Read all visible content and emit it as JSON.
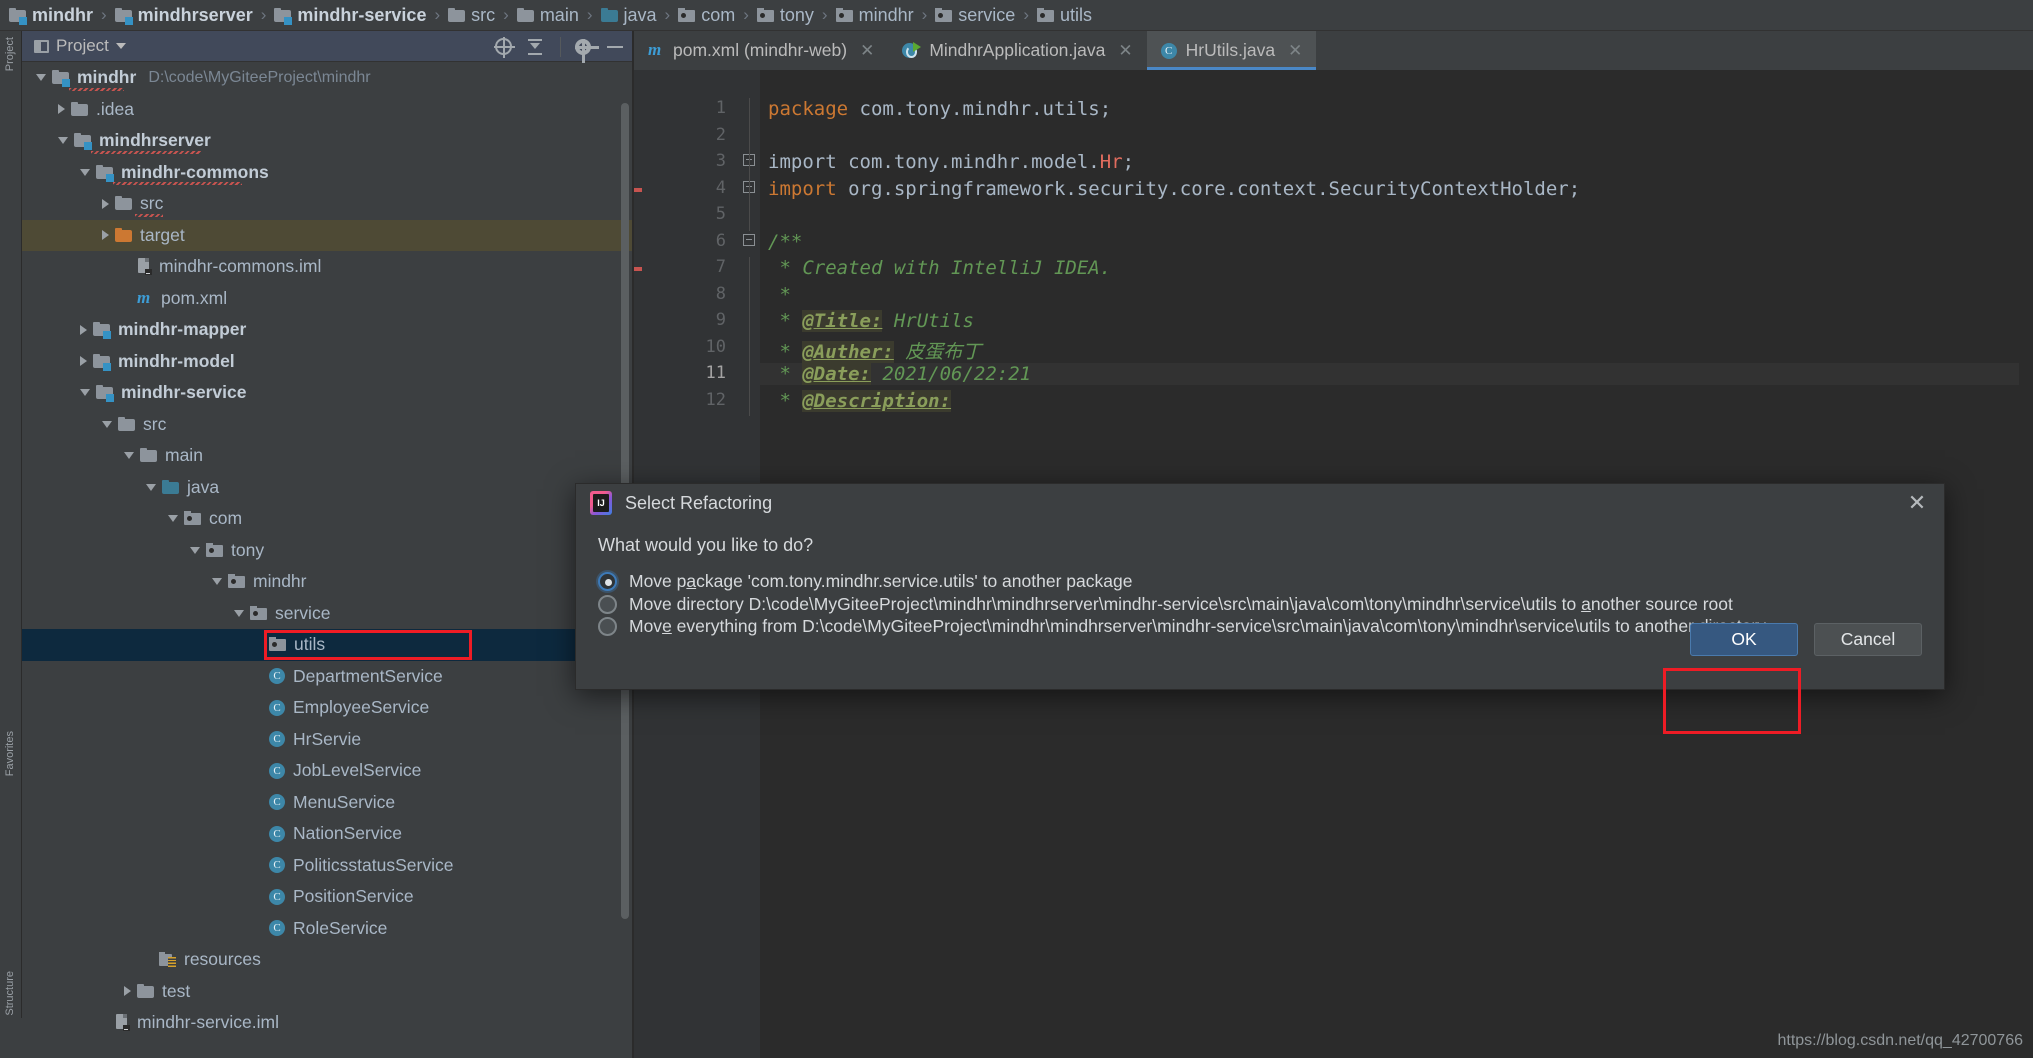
{
  "breadcrumb": [
    {
      "label": "mindhr",
      "icon": "module-folder-icon",
      "bold": true
    },
    {
      "label": "mindhrserver",
      "icon": "module-folder-icon",
      "bold": true
    },
    {
      "label": "mindhr-service",
      "icon": "module-folder-icon",
      "bold": true
    },
    {
      "label": "src",
      "icon": "folder-icon",
      "bold": false
    },
    {
      "label": "main",
      "icon": "folder-icon",
      "bold": false
    },
    {
      "label": "java",
      "icon": "source-folder-icon",
      "bold": false
    },
    {
      "label": "com",
      "icon": "package-folder-icon",
      "bold": false
    },
    {
      "label": "tony",
      "icon": "package-folder-icon",
      "bold": false
    },
    {
      "label": "mindhr",
      "icon": "package-folder-icon",
      "bold": false
    },
    {
      "label": "service",
      "icon": "package-folder-icon",
      "bold": false
    },
    {
      "label": "utils",
      "icon": "package-folder-icon",
      "bold": false
    }
  ],
  "left_rail": {
    "project": "Project",
    "favorites": "Favorites",
    "structure": "Structure"
  },
  "project_panel": {
    "title": "Project",
    "tools": [
      "locate-icon",
      "collapse-all-icon",
      "settings-gear-icon",
      "hide-icon"
    ]
  },
  "tree": [
    {
      "indent": 0,
      "arrow": "open",
      "icon": "module-folder-icon",
      "label": "mindhr",
      "bold": true,
      "path": "D:\\code\\MyGiteeProject\\mindhr",
      "squiggle": true
    },
    {
      "indent": 1,
      "arrow": "closed",
      "icon": "folder-icon",
      "label": ".idea",
      "bold": false
    },
    {
      "indent": 1,
      "arrow": "open",
      "icon": "module-folder-icon",
      "label": "mindhrserver",
      "bold": true,
      "squiggle": true
    },
    {
      "indent": 2,
      "arrow": "open",
      "icon": "module-folder-icon",
      "label": "mindhr-commons",
      "bold": true,
      "squiggle": true
    },
    {
      "indent": 3,
      "arrow": "closed",
      "icon": "folder-icon",
      "label": "src",
      "bold": false,
      "squiggle": true
    },
    {
      "indent": 3,
      "arrow": "closed",
      "icon": "folder-orange-icon",
      "label": "target",
      "bold": false,
      "highlight": true
    },
    {
      "indent": 4,
      "arrow": "none",
      "icon": "iml-file-icon",
      "label": "mindhr-commons.iml",
      "bold": false
    },
    {
      "indent": 4,
      "arrow": "none",
      "icon": "maven-pom-icon",
      "label": "pom.xml",
      "bold": false
    },
    {
      "indent": 2,
      "arrow": "closed",
      "icon": "module-folder-icon",
      "label": "mindhr-mapper",
      "bold": true
    },
    {
      "indent": 2,
      "arrow": "closed",
      "icon": "module-folder-icon",
      "label": "mindhr-model",
      "bold": true
    },
    {
      "indent": 2,
      "arrow": "open",
      "icon": "module-folder-icon",
      "label": "mindhr-service",
      "bold": true
    },
    {
      "indent": 3,
      "arrow": "open",
      "icon": "folder-icon",
      "label": "src",
      "bold": false
    },
    {
      "indent": 4,
      "arrow": "open",
      "icon": "folder-icon",
      "label": "main",
      "bold": false
    },
    {
      "indent": 5,
      "arrow": "open",
      "icon": "source-folder-icon",
      "label": "java",
      "bold": false
    },
    {
      "indent": 6,
      "arrow": "open",
      "icon": "package-folder-icon",
      "label": "com",
      "bold": false
    },
    {
      "indent": 7,
      "arrow": "open",
      "icon": "package-folder-icon",
      "label": "tony",
      "bold": false
    },
    {
      "indent": 8,
      "arrow": "open",
      "icon": "package-folder-icon",
      "label": "mindhr",
      "bold": false
    },
    {
      "indent": 9,
      "arrow": "open",
      "icon": "package-folder-icon",
      "label": "service",
      "bold": false
    },
    {
      "indent": 10,
      "arrow": "none",
      "icon": "package-folder-icon",
      "label": "utils",
      "bold": false,
      "selected": true,
      "annotated": true
    },
    {
      "indent": 10,
      "arrow": "none",
      "icon": "java-class-icon",
      "label": "DepartmentService",
      "bold": false
    },
    {
      "indent": 10,
      "arrow": "none",
      "icon": "java-class-icon",
      "label": "EmployeeService",
      "bold": false
    },
    {
      "indent": 10,
      "arrow": "none",
      "icon": "java-class-icon",
      "label": "HrServie",
      "bold": false
    },
    {
      "indent": 10,
      "arrow": "none",
      "icon": "java-class-icon",
      "label": "JobLevelService",
      "bold": false
    },
    {
      "indent": 10,
      "arrow": "none",
      "icon": "java-class-icon",
      "label": "MenuService",
      "bold": false
    },
    {
      "indent": 10,
      "arrow": "none",
      "icon": "java-class-icon",
      "label": "NationService",
      "bold": false
    },
    {
      "indent": 10,
      "arrow": "none",
      "icon": "java-class-icon",
      "label": "PoliticsstatusService",
      "bold": false
    },
    {
      "indent": 10,
      "arrow": "none",
      "icon": "java-class-icon",
      "label": "PositionService",
      "bold": false
    },
    {
      "indent": 10,
      "arrow": "none",
      "icon": "java-class-icon",
      "label": "RoleService",
      "bold": false
    },
    {
      "indent": 5,
      "arrow": "none",
      "icon": "resources-folder-icon",
      "label": "resources",
      "bold": false
    },
    {
      "indent": 4,
      "arrow": "closed",
      "icon": "folder-icon",
      "label": "test",
      "bold": false
    },
    {
      "indent": 3,
      "arrow": "none",
      "icon": "iml-file-icon",
      "label": "mindhr-service.iml",
      "bold": false
    }
  ],
  "editor": {
    "tabs": [
      {
        "label": "pom.xml (mindhr-web)",
        "icon": "maven-pom-icon",
        "active": false,
        "closable": true
      },
      {
        "label": "MindhrApplication.java",
        "icon": "spring-boot-icon",
        "active": false,
        "closable": true
      },
      {
        "label": "HrUtils.java",
        "icon": "java-class-icon",
        "active": true,
        "closable": true
      }
    ],
    "line_numbers": [
      "1",
      "2",
      "3",
      "4",
      "5",
      "6",
      "7",
      "8",
      "9",
      "10",
      "11",
      "12"
    ],
    "current_line": "11",
    "code_lines": [
      {
        "n": 1,
        "tokens": [
          {
            "t": "package ",
            "c": "kw"
          },
          {
            "t": "com.tony.mindhr.utils;",
            "c": "pl"
          }
        ]
      },
      {
        "n": 2,
        "tokens": []
      },
      {
        "n": 3,
        "tokens": [
          {
            "t": "import ",
            "c": "pl"
          },
          {
            "t": "com.tony.mindhr.model.",
            "c": "pl"
          },
          {
            "t": "Hr",
            "c": "cls"
          },
          {
            "t": ";",
            "c": "pl"
          }
        ]
      },
      {
        "n": 4,
        "tokens": [
          {
            "t": "import ",
            "c": "kw"
          },
          {
            "t": "org.springframework.security.core.context.SecurityContextHolder;",
            "c": "pl"
          }
        ]
      },
      {
        "n": 5,
        "tokens": []
      },
      {
        "n": 6,
        "tokens": [
          {
            "t": "/**",
            "c": "cmt"
          }
        ]
      },
      {
        "n": 7,
        "tokens": [
          {
            "t": " * Created with IntelliJ IDEA.",
            "c": "cmt"
          }
        ]
      },
      {
        "n": 8,
        "tokens": [
          {
            "t": " *",
            "c": "cmt"
          }
        ]
      },
      {
        "n": 9,
        "tokens": [
          {
            "t": " * ",
            "c": "cmt"
          },
          {
            "t": "@Title:",
            "c": "tag"
          },
          {
            "t": " HrUtils",
            "c": "tagv"
          }
        ]
      },
      {
        "n": 10,
        "tokens": [
          {
            "t": " * ",
            "c": "cmt"
          },
          {
            "t": "@Auther:",
            "c": "tag"
          },
          {
            "t": " 皮蛋布丁",
            "c": "tagv"
          }
        ]
      },
      {
        "n": 11,
        "tokens": [
          {
            "t": " * ",
            "c": "cmt"
          },
          {
            "t": "@Date:",
            "c": "tag"
          },
          {
            "t": " 2021/06/22:21",
            "c": "tagv"
          }
        ]
      },
      {
        "n": 12,
        "tokens": [
          {
            "t": " * ",
            "c": "cmt"
          },
          {
            "t": "@Description:",
            "c": "tag"
          }
        ]
      }
    ],
    "watermark": "https://blog.csdn.net/qq_42700766"
  },
  "dialog": {
    "title": "Select Refactoring",
    "question": "What would you like to do?",
    "close_icon": "close-icon",
    "options": [
      {
        "selected": true,
        "prefix": "Move p",
        "mnemonic": "a",
        "suffix": "ckage 'com.tony.mindhr.service.utils' to another package"
      },
      {
        "selected": false,
        "prefix": "Move directory D:\\code\\MyGiteeProject\\mindhr\\mindhrserver\\mindhr-service\\src\\main\\java\\com\\tony\\mindhr\\service\\utils to ",
        "mnemonic": "a",
        "suffix": "nother source root"
      },
      {
        "selected": false,
        "prefix": "Mov",
        "mnemonic": "e",
        "suffix": " everything from D:\\code\\MyGiteeProject\\mindhr\\mindhrserver\\mindhr-service\\src\\main\\java\\com\\tony\\mindhr\\service\\utils to another directory"
      }
    ],
    "ok_label": "OK",
    "cancel_label": "Cancel"
  },
  "annotations": {
    "accent_color": "#ee1c25"
  }
}
